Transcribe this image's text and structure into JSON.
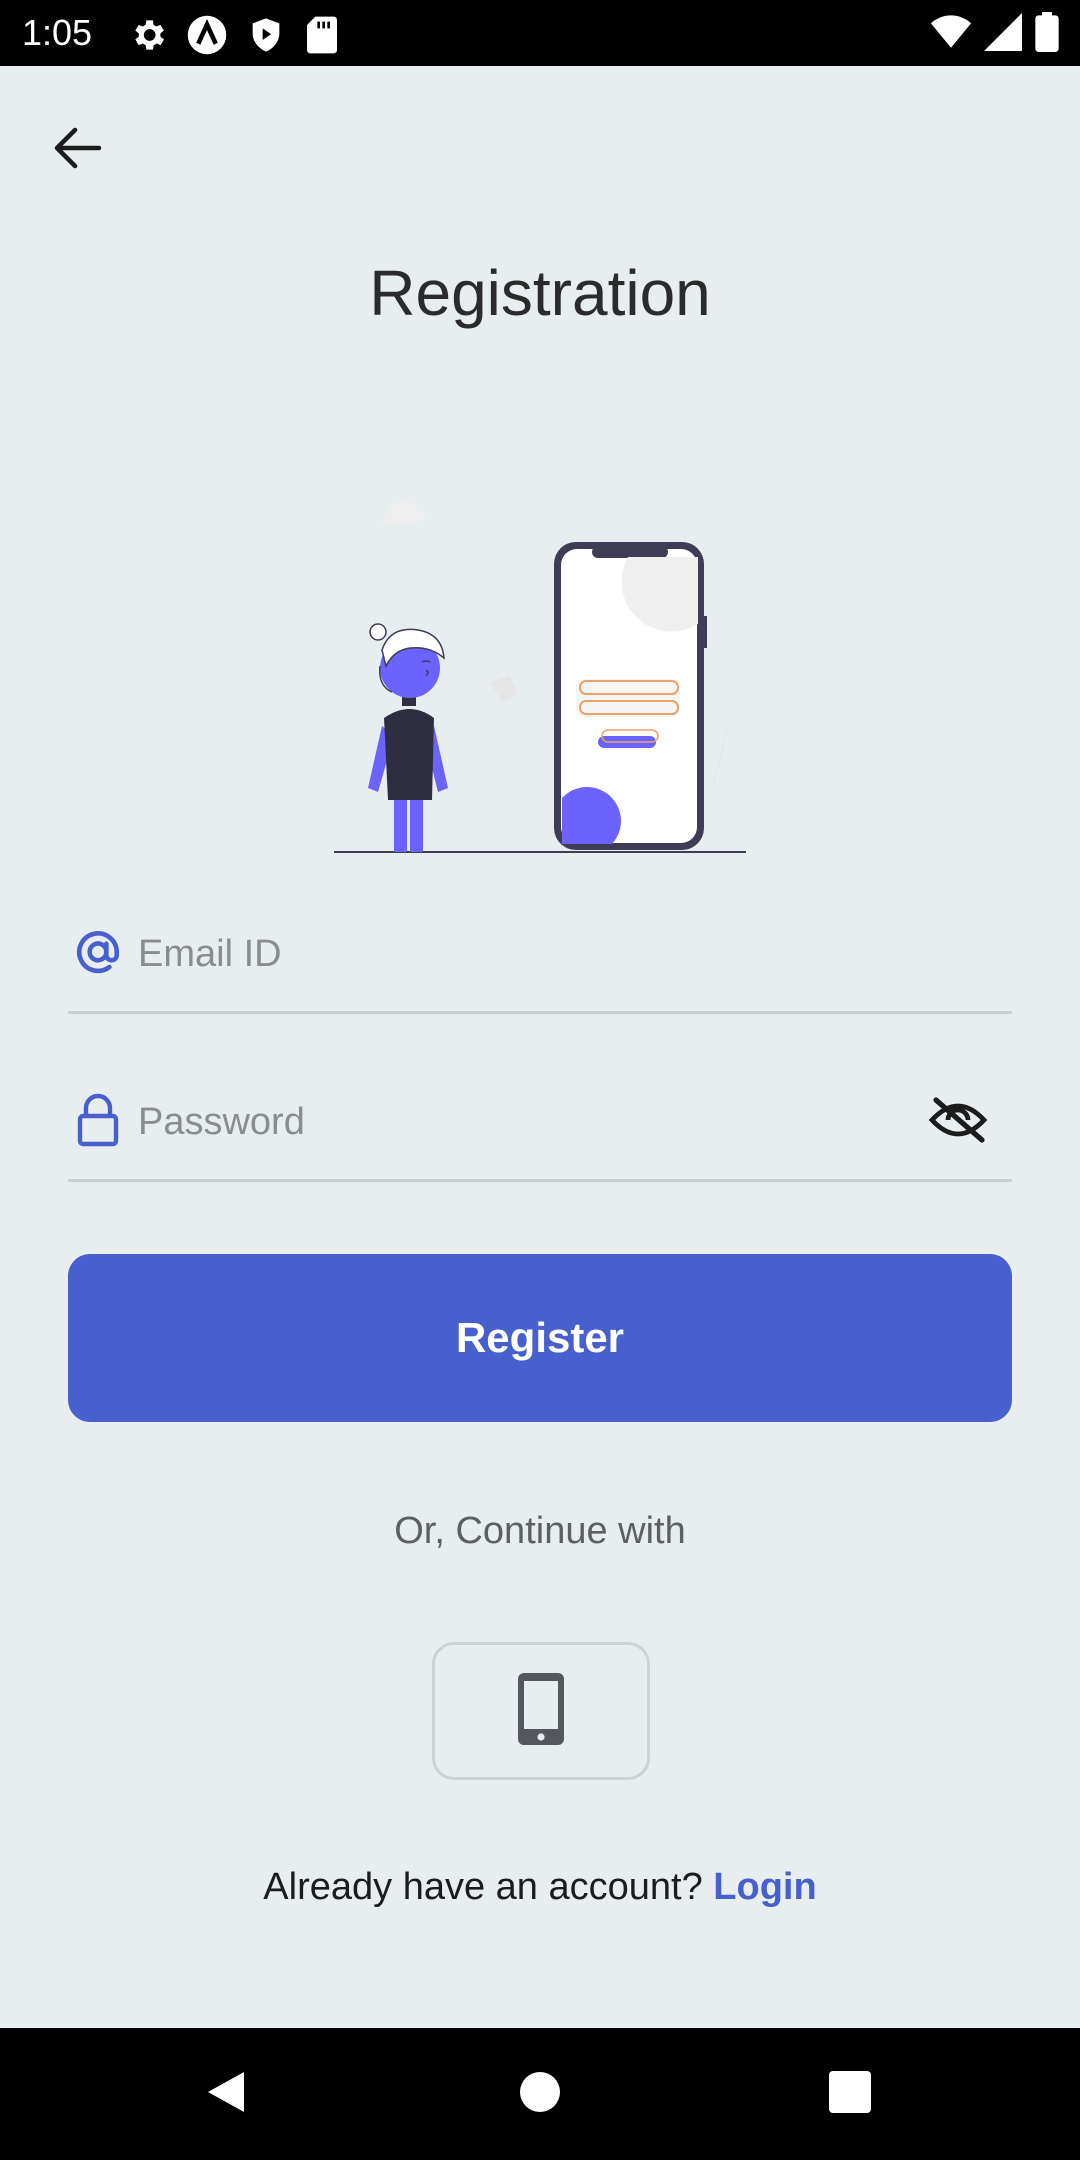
{
  "status_bar": {
    "time": "1:05",
    "left_icons": [
      "settings-icon",
      "autofill-icon",
      "shield-icon",
      "sd-card-icon"
    ],
    "right_icons": [
      "wifi-icon",
      "signal-icon",
      "battery-icon"
    ]
  },
  "header": {
    "back_icon": "arrow-back-icon",
    "title": "Registration"
  },
  "form": {
    "email": {
      "placeholder": "Email ID",
      "value": "",
      "icon": "at-sign-icon"
    },
    "password": {
      "placeholder": "Password",
      "value": "",
      "icon": "lock-icon",
      "toggle_icon": "eye-off-icon"
    },
    "register_label": "Register"
  },
  "alt_login": {
    "divider_text": "Or, Continue with",
    "phone_icon": "smartphone-icon"
  },
  "footer": {
    "prompt": "Already have an account? ",
    "login_label": "Login"
  },
  "colors": {
    "background": "#e8eef0",
    "accent": "#4760cd",
    "illustration_accent": "#6c63ff",
    "text_dark": "#2b2b2b"
  },
  "nav_bar": [
    "back-triangle-icon",
    "home-circle-icon",
    "recents-square-icon"
  ]
}
